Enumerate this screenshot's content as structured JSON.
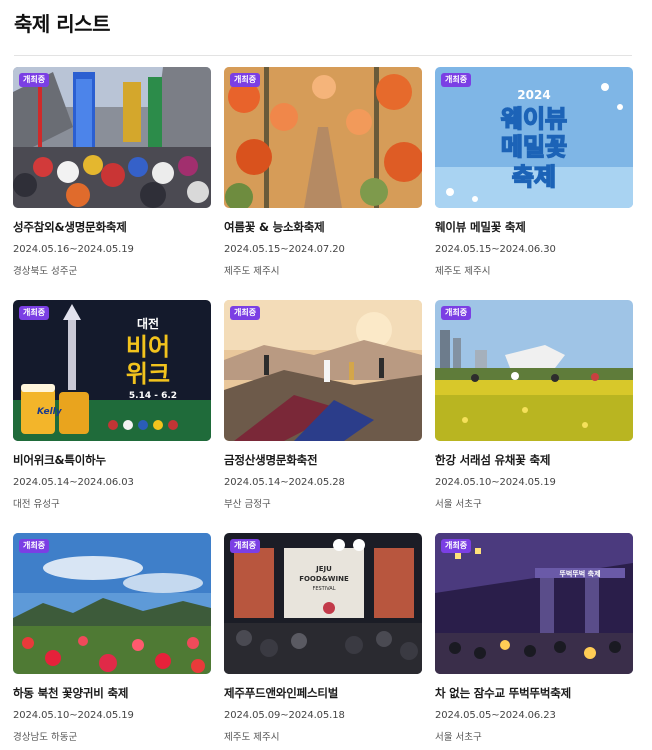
{
  "page": {
    "title": "축제 리스트"
  },
  "colors": {
    "badge": "#7b3fe4",
    "divider": "#e3e3e3"
  },
  "festivals": [
    {
      "badge": "개최중",
      "name": "성주참외&생명문화축제",
      "period": "2024.05.16~2024.05.19",
      "location": "경상북도 성주군",
      "image": "parade-photo"
    },
    {
      "badge": "개최중",
      "name": "여름꽃 & 능소화축제",
      "period": "2024.05.15~2024.07.20",
      "location": "제주도 제주시",
      "image": "trumpet-vine-path-photo"
    },
    {
      "badge": "개최중",
      "name": "웨이뷰 메밀꽃 축제",
      "period": "2024.05.15~2024.06.30",
      "location": "제주도 제주시",
      "image": "festival-poster",
      "poster_text": {
        "year": "2024",
        "line1": "웨이뷰",
        "line2": "메밀꽃",
        "line3": "축제"
      }
    },
    {
      "badge": "개최중",
      "name": "비어위크&특이하누",
      "period": "2024.05.14~2024.06.03",
      "location": "대전 유성구",
      "image": "beer-week-poster",
      "poster_text": {
        "line1": "대전",
        "line2": "비어",
        "line3": "위크",
        "dates": "5.14 - 6.2",
        "brand": "Kelly"
      }
    },
    {
      "badge": "개최중",
      "name": "금정산생명문화축전",
      "period": "2024.05.14~2024.05.28",
      "location": "부산 금정구",
      "image": "mountain-ritual-photo"
    },
    {
      "badge": "개최중",
      "name": "한강 서래섬 유채꽃 축제",
      "period": "2024.05.10~2024.05.19",
      "location": "서울 서초구",
      "image": "canola-field-photo"
    },
    {
      "badge": "개최중",
      "name": "하동 북천 꽃양귀비 축제",
      "period": "2024.05.10~2024.05.19",
      "location": "경상남도 하동군",
      "image": "poppy-field-photo"
    },
    {
      "badge": "개최중",
      "name": "제주푸드앤와인페스티벌",
      "period": "2024.05.09~2024.05.18",
      "location": "제주도 제주시",
      "image": "food-wine-event-photo",
      "poster_text": {
        "line1": "JEJU",
        "line2": "FOOD&WINE",
        "line3": "FESTIVAL"
      }
    },
    {
      "badge": "개최중",
      "name": "차 없는 잠수교 뚜벅뚜벅축제",
      "period": "2024.05.05~2024.06.23",
      "location": "서울 서초구",
      "image": "bridge-night-photo",
      "poster_text": {
        "sign": "뚜벅뚜벅 축제"
      }
    }
  ]
}
